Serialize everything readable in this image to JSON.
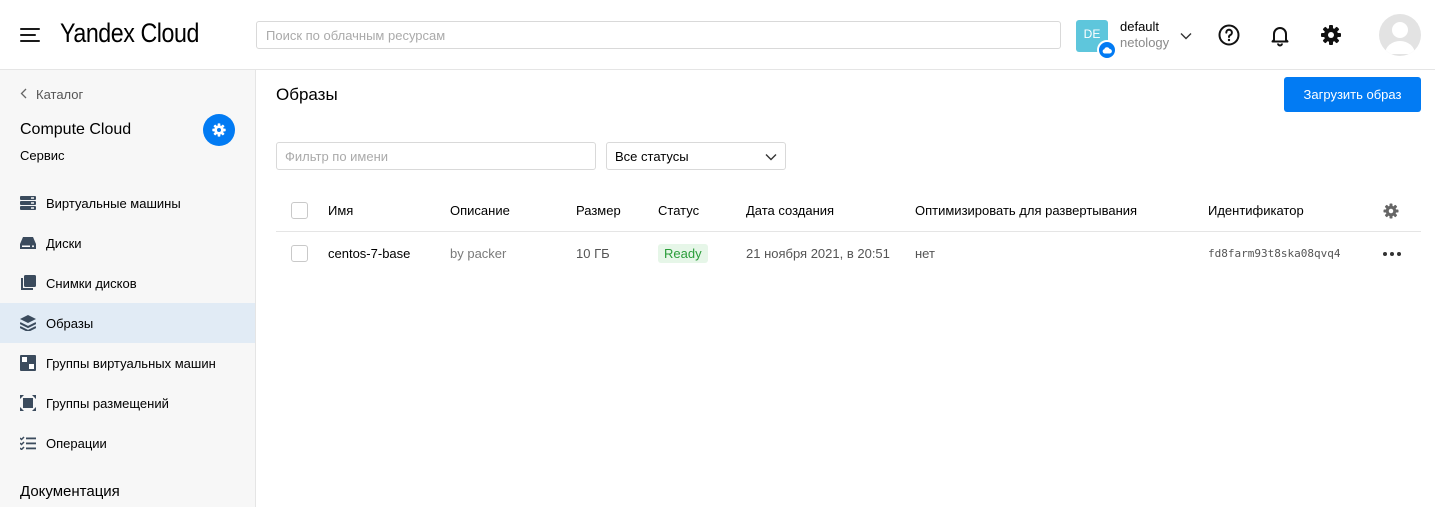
{
  "header": {
    "logo": "Yandex Cloud",
    "search_placeholder": "Поиск по облачным ресурсам",
    "cloud_badge": "DE",
    "cloud_name": "default",
    "cloud_sub": "netology"
  },
  "sidebar": {
    "back_label": "Каталог",
    "service_title": "Compute Cloud",
    "service_sub": "Сервис",
    "items": [
      {
        "label": "Виртуальные машины",
        "icon": "server-icon"
      },
      {
        "label": "Диски",
        "icon": "disk-icon"
      },
      {
        "label": "Снимки дисков",
        "icon": "snapshot-icon"
      },
      {
        "label": "Образы",
        "icon": "layers-icon",
        "active": true
      },
      {
        "label": "Группы виртуальных машин",
        "icon": "instance-group-icon"
      },
      {
        "label": "Группы размещений",
        "icon": "placement-group-icon"
      },
      {
        "label": "Операции",
        "icon": "operations-list-icon"
      }
    ],
    "docs_label": "Документация"
  },
  "main": {
    "title": "Образы",
    "upload_label": "Загрузить образ",
    "filter_placeholder": "Фильтр по имени",
    "status_filter": "Все статусы",
    "columns": [
      "Имя",
      "Описание",
      "Размер",
      "Статус",
      "Дата создания",
      "Оптимизировать для развертывания",
      "Идентификатор"
    ],
    "rows": [
      {
        "name": "centos-7-base",
        "description": "by packer",
        "size": "10 ГБ",
        "status": "Ready",
        "created": "21 ноября 2021, в 20:51",
        "optimize": "нет",
        "id": "fd8farm93t8ska08qvq4"
      }
    ]
  },
  "colors": {
    "accent": "#027bf3",
    "active_nav": "#e1ebf5",
    "ready_bg": "#e6f6e8",
    "ready_text": "#2a9d3a",
    "badge": "#5ec6dc"
  }
}
